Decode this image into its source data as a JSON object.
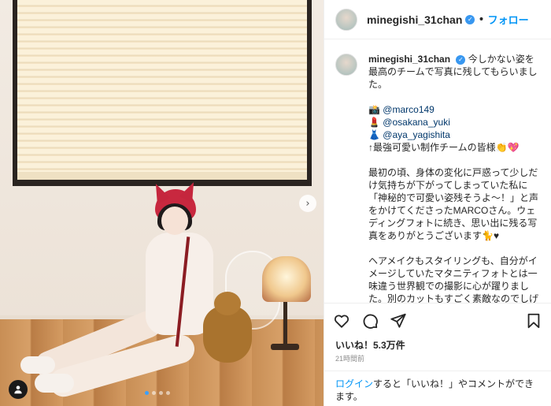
{
  "post": {
    "username": "minegishi_31chan",
    "follow_label": "フォロー",
    "separator": "•",
    "caption": {
      "intro": "今しかない姿を最高のチームで写真に残してもらいました。",
      "credits": [
        {
          "emoji": "📸",
          "handle": "@marco149"
        },
        {
          "emoji": "💄",
          "handle": "@osakana_yuki"
        },
        {
          "emoji": "👗",
          "handle": "@aya_yagishita"
        }
      ],
      "team_line": "↑最強可愛い制作チームの皆様👏💖",
      "paragraph1": "最初の頃、身体の変化に戸惑って少しだけ気持ちが下がってしまっていた私に「神秘的で可愛い姿残そうよ〜！」と声をかけてくださったMARCOさん。ウェディングフォトに続き、思い出に残る写真をありがとうございます🐈♥",
      "paragraph2": "ヘアメイクもスタイリングも、自分がイメージしていたマタニティフォトとは一味違う世界観での撮影に心が躍りました。別のカットもすごく素敵なのでしげしお付き合いいただけると幸い"
    },
    "likes": "いいね！5.3万件",
    "time": "21時間前"
  },
  "login_bar": {
    "link": "ログイン",
    "text": "すると「いいね！」やコメントができます。"
  },
  "carousel": {
    "slide_count": 4,
    "active_index": 0
  },
  "colors": {
    "accent": "#0095f6",
    "verified": "#3897f0",
    "mention": "#00376b"
  }
}
